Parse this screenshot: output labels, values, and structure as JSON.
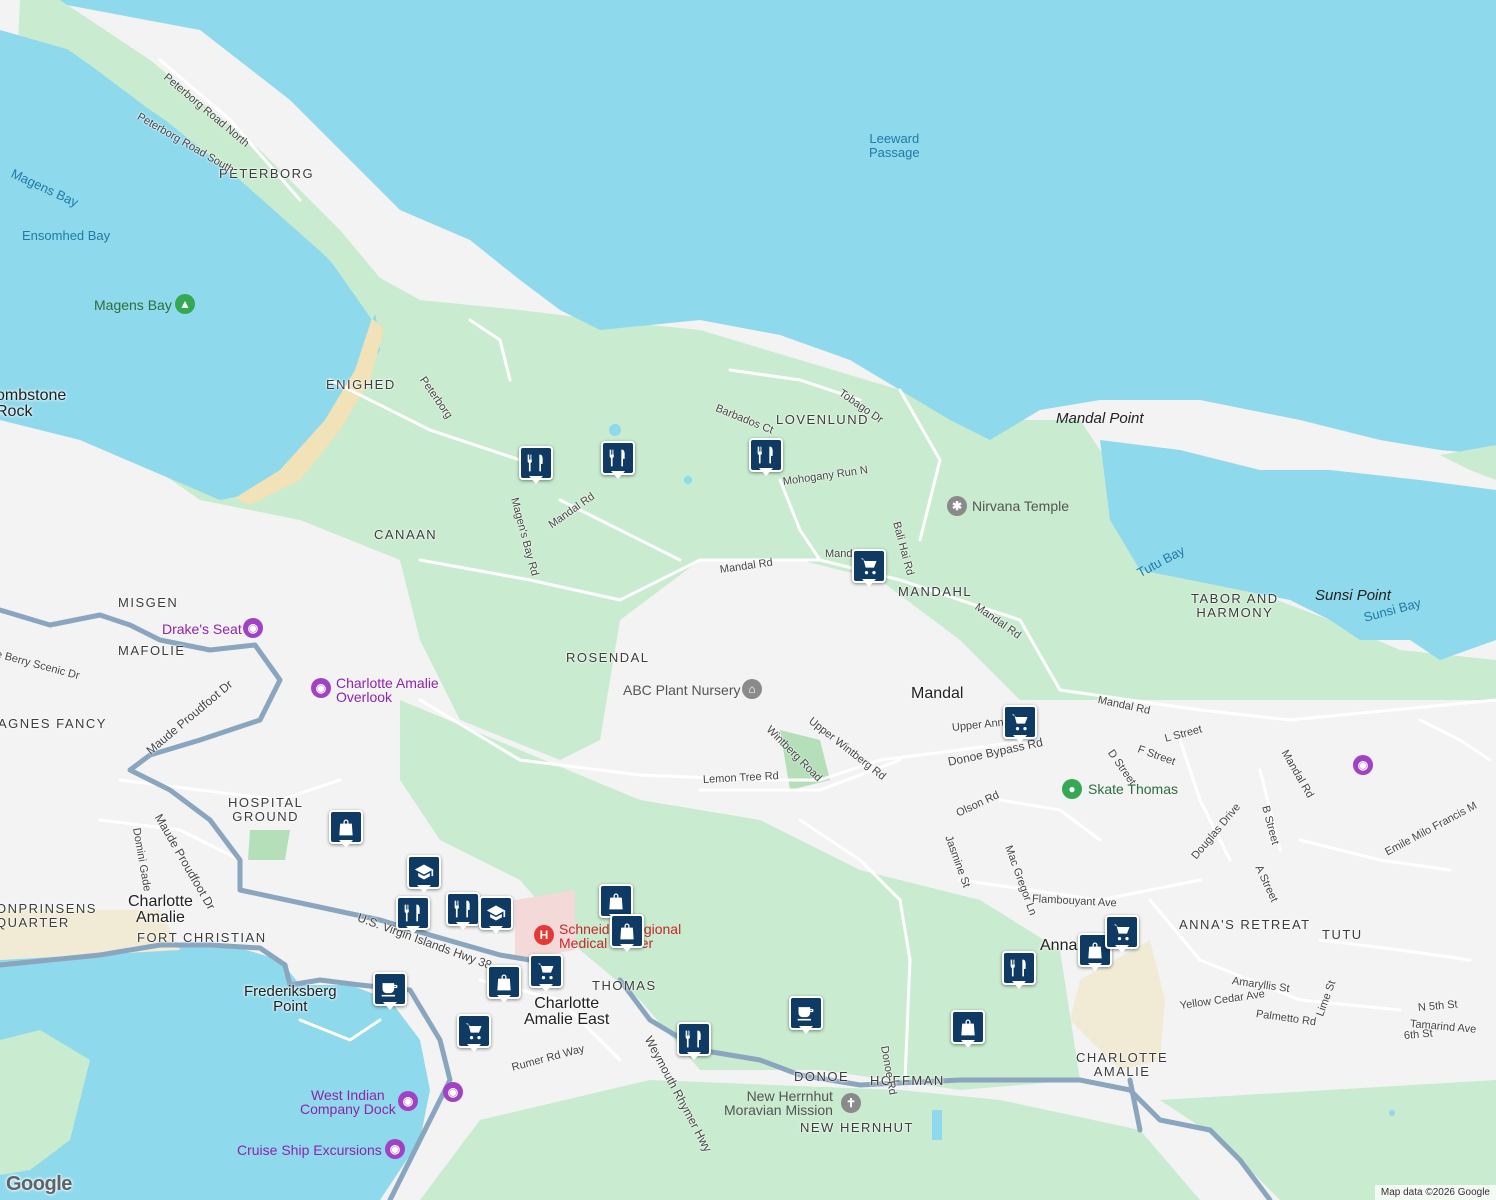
{
  "map": {
    "colors": {
      "water": "#8fd9ec",
      "land": "#f3f3f4",
      "park": "#c9ebcf",
      "road": "#ffffff",
      "highway": "#8aa6bf",
      "beach": "#f1e2b7",
      "pin": "#0e3a63"
    },
    "labels": {
      "leeward_passage": "Leeward\nPassage",
      "magens_bay_water": "Magens Bay",
      "ensomhed_bay": "Ensomhed Bay",
      "tutu_bay": "Tutu Bay",
      "sunsi_bay": "Sunsi Bay",
      "mandal_point": "Mandal Point",
      "sunsi_point": "Sunsi Point",
      "tombstone_rock": "ombstone\nRock",
      "frederiksberg_point": "Frederiksberg\nPoint",
      "peterborg": "PETERBORG",
      "enighed": "ENIGHED",
      "canaan": "CANAAN",
      "misgen": "MISGEN",
      "mafolie": "MAFOLIE",
      "agnes_fancy": "AGNES FANCY",
      "hospital_ground": "HOSPITAL\nGROUND",
      "kronprinsens_quarter": "ONPRINSENS\nQUARTER",
      "fort_christian": "FORT CHRISTIAN",
      "rosendal": "ROSENDAL",
      "lovenlund": "LOVENLUND",
      "mandahl": "MANDAHL",
      "tabor_harmony": "TABOR AND\nHARMONY",
      "annas_retreat": "ANNA'S RETREAT",
      "tutu": "TUTU",
      "charlotte_amalie_area": "CHARLOTTE\nAMALIE",
      "donoe": "DONOE",
      "hoffman": "HOFFMAN",
      "new_hernhut": "NEW HERNHUT",
      "thomas": "THOMAS",
      "mandal_town": "Mandal",
      "charlotte_amalie_town": "Charlotte\nAmalie",
      "charlotte_amalie_east": "Charlotte\nAmalie East",
      "anna_town": "Anna"
    },
    "roads": {
      "peterborg_north": "Peterborg Road North",
      "peterborg_south": "Peterborg Road South",
      "peterborg": "Peterborg",
      "magens_bay_rd": "Magen's Bay Rd",
      "mandal_rd_1": "Mandal Rd",
      "mandal_rd_2": "Mandal Rd",
      "mandal_rd_3": "Mand",
      "mandal_rd_4": "Mandal Rd",
      "mandal_rd_5": "Mandal Rd",
      "mandal_rd_6": "Mandal Rd",
      "tobago_dr": "Tobago Dr",
      "barbados_ct": "Barbados Ct",
      "mohogany_run": "Mohogany Run N",
      "bali_hai_rd": "Bali Hai Rd",
      "wintberg_road": "Wintberg Road",
      "upper_wintberg": "Upper Wintberg Rd",
      "upper_anna": "Upper Ann",
      "donoe_bypass": "Donoe Bypass Rd",
      "lemon_tree": "Lemon Tree Rd",
      "d_street": "D Street",
      "f_street": "F Street",
      "l_street": "L Street",
      "b_street": "B Street",
      "a_street": "A Street",
      "olson_rd": "Olson Rd",
      "jasmine_st": "Jasmine St",
      "mac_gregor": "Mac Gregor Ln",
      "douglas_drive": "Douglas Drive",
      "flambouyant": "Flambouyant Ave",
      "emile_milo": "Emile Milo Francis M",
      "amaryllis": "Amaryllis St",
      "yellow_cedar": "Yellow Cedar Ave",
      "palmetto": "Palmetto Rd",
      "lime_st": "Lime St",
      "n5th": "N 5th St",
      "tamarind": "Tamarind Ave",
      "sixth": "6th St",
      "donoe_rd": "Donoe Rd",
      "weymouth": "Weymouth Rhymer Hwy",
      "rumer": "Rumer Rd Way",
      "maude_1": "Maude Proudfoot Dr",
      "maude_2": "Maude Proudfoot Dr",
      "domini": "Domini Gade",
      "usvi_hwy": "U.S. Virgin Islands Hwy 38",
      "berry_scenic": "e Berry Scenic Dr"
    },
    "pois": {
      "magens_bay_park": "Magens Bay",
      "nirvana_temple": "Nirvana Temple",
      "drakes_seat": "Drake's Seat",
      "charlotte_overlook": "Charlotte Amalie\nOverlook",
      "abc_nursery": "ABC Plant Nursery",
      "skate_thomas": "Skate Thomas",
      "schneider": "Schneider Regional\nMedical Center",
      "moravian": "New Herrnhut\nMoravian Mission",
      "west_indian_dock": "West Indian\nCompany Dock",
      "cruise_ship": "Cruise Ship Excursions"
    },
    "markers": [
      {
        "type": "restaurant-icon"
      },
      {
        "type": "restaurant-icon"
      },
      {
        "type": "restaurant-icon"
      },
      {
        "type": "cart-icon"
      },
      {
        "type": "cart-icon"
      },
      {
        "type": "shopping-bag-icon"
      },
      {
        "type": "school-icon"
      },
      {
        "type": "restaurant-icon"
      },
      {
        "type": "restaurant-icon"
      },
      {
        "type": "school-icon"
      },
      {
        "type": "shopping-bag-icon"
      },
      {
        "type": "shopping-bag-icon"
      },
      {
        "type": "cart-icon"
      },
      {
        "type": "shopping-bag-icon"
      },
      {
        "type": "coffee-icon"
      },
      {
        "type": "cart-icon"
      },
      {
        "type": "restaurant-icon"
      },
      {
        "type": "coffee-icon"
      },
      {
        "type": "shopping-bag-icon"
      },
      {
        "type": "restaurant-icon"
      },
      {
        "type": "shopping-bag-icon"
      },
      {
        "type": "cart-icon"
      }
    ],
    "logo": "Google",
    "attribution": "Map data ©2026 Google"
  }
}
